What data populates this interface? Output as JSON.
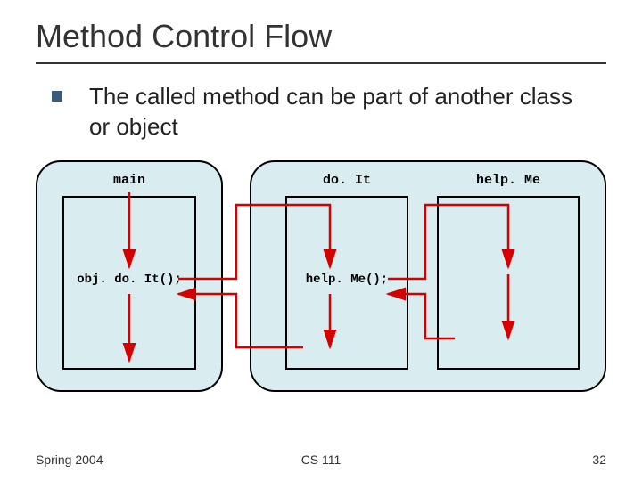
{
  "title": "Method Control Flow",
  "bullet_text": "The called method can be part of another class or object",
  "labels": {
    "main": "main",
    "doit": "do. It",
    "helpme": "help. Me"
  },
  "calls": {
    "obj_doit": "obj. do. It();",
    "helpme": "help. Me();"
  },
  "footer": {
    "left": "Spring 2004",
    "center": "CS 111",
    "right": "32"
  }
}
